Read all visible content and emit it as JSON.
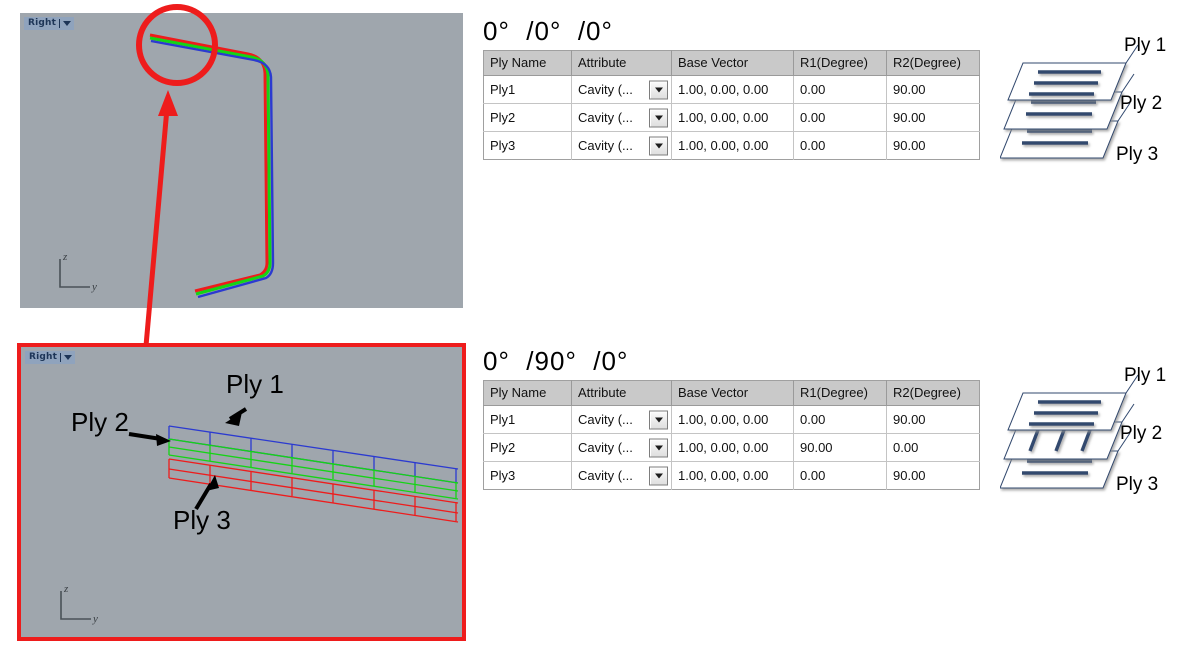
{
  "viewports": {
    "top": {
      "view_label": "Right",
      "axis": {
        "vertical": "z",
        "horizontal": "y"
      }
    },
    "detail": {
      "view_label": "Right",
      "axis": {
        "vertical": "z",
        "horizontal": "y"
      },
      "callouts": [
        {
          "name": "ply1",
          "label": "Ply 1"
        },
        {
          "name": "ply2",
          "label": "Ply 2"
        },
        {
          "name": "ply3",
          "label": "Ply 3"
        }
      ]
    }
  },
  "sections": [
    {
      "id": "section-1",
      "angle_title": "0°  /0°  /0°",
      "table": {
        "columns": [
          "Ply Name",
          "Attribute",
          "Base Vector",
          "R1(Degree)",
          "R2(Degree)"
        ],
        "rows": [
          {
            "ply_name": "Ply1",
            "attribute": "Cavity (...",
            "base_vector": "1.00, 0.00, 0.00",
            "r1": "0.00",
            "r2": "90.00"
          },
          {
            "ply_name": "Ply2",
            "attribute": "Cavity (...",
            "base_vector": "1.00, 0.00, 0.00",
            "r1": "0.00",
            "r2": "90.00"
          },
          {
            "ply_name": "Ply3",
            "attribute": "Cavity (...",
            "base_vector": "1.00, 0.00, 0.00",
            "r1": "0.00",
            "r2": "90.00"
          }
        ]
      },
      "stack": {
        "labels": [
          "Ply 1",
          "Ply 2",
          "Ply 3"
        ],
        "orientations": [
          "horizontal",
          "horizontal",
          "horizontal"
        ]
      }
    },
    {
      "id": "section-2",
      "angle_title": "0°  /90°  /0°",
      "table": {
        "columns": [
          "Ply Name",
          "Attribute",
          "Base Vector",
          "R1(Degree)",
          "R2(Degree)"
        ],
        "rows": [
          {
            "ply_name": "Ply1",
            "attribute": "Cavity (...",
            "base_vector": "1.00, 0.00, 0.00",
            "r1": "0.00",
            "r2": "90.00"
          },
          {
            "ply_name": "Ply2",
            "attribute": "Cavity (...",
            "base_vector": "1.00, 0.00, 0.00",
            "r1": "90.00",
            "r2": "0.00"
          },
          {
            "ply_name": "Ply3",
            "attribute": "Cavity (...",
            "base_vector": "1.00, 0.00, 0.00",
            "r1": "0.00",
            "r2": "90.00"
          }
        ]
      },
      "stack": {
        "labels": [
          "Ply 1",
          "Ply 2",
          "Ply 3"
        ],
        "orientations": [
          "horizontal",
          "vertical",
          "horizontal"
        ]
      }
    }
  ],
  "colors": {
    "ply1": "#2b3ad0",
    "ply2": "#15d415",
    "ply3": "#ee1c1c",
    "annotation_red": "#ee1c1c",
    "viewport_bg": "#9fa6ad",
    "stack_line": "#31486e"
  },
  "icons": {
    "view_dropdown": "chevron-down-icon",
    "attribute_dropdown": "chevron-down-icon"
  }
}
